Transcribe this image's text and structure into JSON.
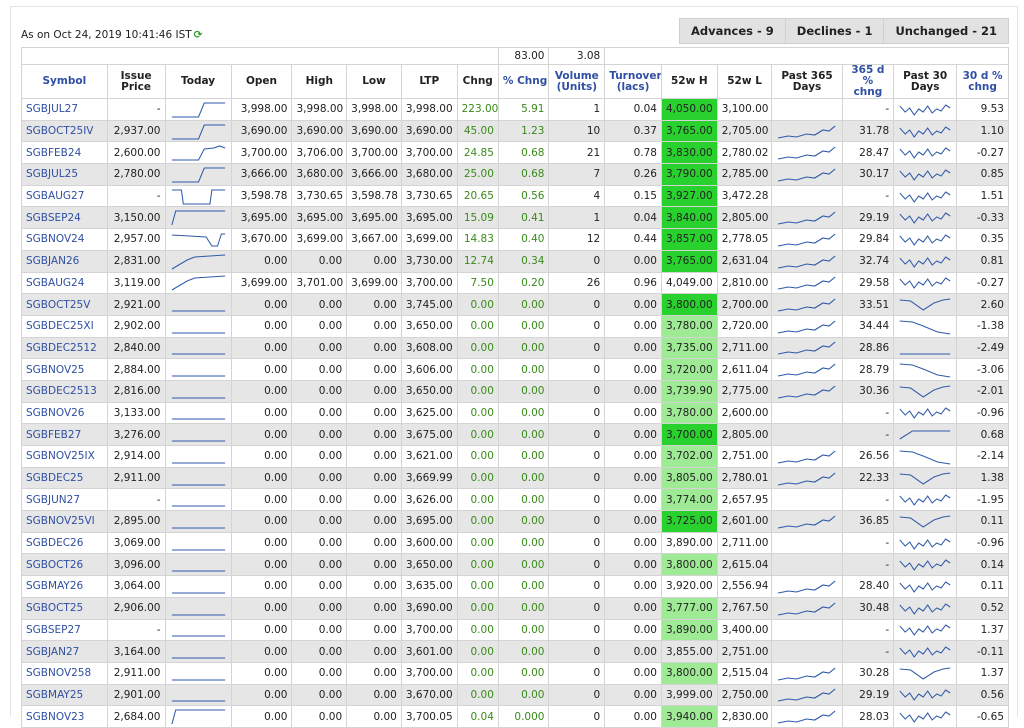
{
  "header": {
    "as_on": "As on Oct 24, 2019 10:41:46 IST",
    "refresh_icon": "refresh-icon",
    "advances": "Advances - 9",
    "declines": "Declines - 1",
    "unchanged": "Unchanged - 21"
  },
  "totals": {
    "pct_chng": "83.00",
    "volume": "3.08"
  },
  "columns": {
    "symbol": "Symbol",
    "issue_price": "Issue Price",
    "today": "Today",
    "open": "Open",
    "high": "High",
    "low": "Low",
    "ltp": "LTP",
    "chng": "Chng",
    "pct_chng": "% Chng",
    "volume": "Volume (Units)",
    "turnover": "Turnover (lacs)",
    "w52h": "52w H",
    "w52l": "52w L",
    "past365": "Past 365 Days",
    "d365chng": "365 d % chng",
    "past30": "Past 30 Days",
    "d30chng": "30 d % chng"
  },
  "colors": {
    "highlight_bright": "#29d12e",
    "highlight_light": "#9fea94",
    "link_blue": "#2f4fa3",
    "change_green": "#3a8a1a",
    "row_stripe": "#e6e6e6"
  },
  "rows": [
    {
      "symbol": "SGBJUL27",
      "issue": "-",
      "open": "3,998.00",
      "high": "3,998.00",
      "low": "3,998.00",
      "ltp": "3,998.00",
      "chng": "223.00",
      "pchng": "5.91",
      "vol": "1",
      "turn": "0.04",
      "h52": "4,050.00",
      "h52hl": "bright",
      "l52": "3,100.00",
      "d365": "-",
      "d30": "9.53",
      "today": "step_up",
      "p365": "none",
      "p30": "zig"
    },
    {
      "symbol": "SGBOCT25IV",
      "issue": "2,937.00",
      "open": "3,690.00",
      "high": "3,690.00",
      "low": "3,690.00",
      "ltp": "3,690.00",
      "chng": "45.00",
      "pchng": "1.23",
      "vol": "10",
      "turn": "0.37",
      "h52": "3,765.00",
      "h52hl": "bright",
      "l52": "2,705.00",
      "d365": "31.78",
      "d30": "1.10",
      "today": "step_up",
      "p365": "rise",
      "p30": "zig"
    },
    {
      "symbol": "SGBFEB24",
      "issue": "2,600.00",
      "open": "3,700.00",
      "high": "3,706.00",
      "low": "3,700.00",
      "ltp": "3,700.00",
      "chng": "24.85",
      "pchng": "0.68",
      "vol": "21",
      "turn": "0.78",
      "h52": "3,830.00",
      "h52hl": "bright",
      "l52": "2,780.02",
      "d365": "28.47",
      "d30": "-0.27",
      "today": "step_up_bump",
      "p365": "rise",
      "p30": "zig"
    },
    {
      "symbol": "SGBJUL25",
      "issue": "2,780.00",
      "open": "3,666.00",
      "high": "3,680.00",
      "low": "3,666.00",
      "ltp": "3,680.00",
      "chng": "25.00",
      "pchng": "0.68",
      "vol": "7",
      "turn": "0.26",
      "h52": "3,790.00",
      "h52hl": "bright",
      "l52": "2,785.00",
      "d365": "30.17",
      "d30": "0.85",
      "today": "step_up",
      "p365": "rise",
      "p30": "zig"
    },
    {
      "symbol": "SGBAUG27",
      "issue": "-",
      "open": "3,598.78",
      "high": "3,730.65",
      "low": "3,598.78",
      "ltp": "3,730.65",
      "chng": "20.65",
      "pchng": "0.56",
      "vol": "4",
      "turn": "0.15",
      "h52": "3,927.00",
      "h52hl": "bright",
      "l52": "3,472.28",
      "d365": "-",
      "d30": "1.51",
      "today": "valley",
      "p365": "none",
      "p30": "zig"
    },
    {
      "symbol": "SGBSEP24",
      "issue": "3,150.00",
      "open": "3,695.00",
      "high": "3,695.00",
      "low": "3,695.00",
      "ltp": "3,695.00",
      "chng": "15.09",
      "pchng": "0.41",
      "vol": "1",
      "turn": "0.04",
      "h52": "3,840.00",
      "h52hl": "bright",
      "l52": "2,805.00",
      "d365": "29.19",
      "d30": "-0.33",
      "today": "step_up_early",
      "p365": "rise",
      "p30": "zig"
    },
    {
      "symbol": "SGBNOV24",
      "issue": "2,957.00",
      "open": "3,670.00",
      "high": "3,699.00",
      "low": "3,667.00",
      "ltp": "3,699.00",
      "chng": "14.83",
      "pchng": "0.40",
      "vol": "12",
      "turn": "0.44",
      "h52": "3,857.00",
      "h52hl": "bright",
      "l52": "2,778.05",
      "d365": "29.84",
      "d30": "0.35",
      "today": "dip_up",
      "p365": "rise",
      "p30": "zig"
    },
    {
      "symbol": "SGBJAN26",
      "issue": "2,831.00",
      "open": "0.00",
      "high": "0.00",
      "low": "0.00",
      "ltp": "3,730.00",
      "chng": "12.74",
      "pchng": "0.34",
      "vol": "0",
      "turn": "0.00",
      "h52": "3,765.00",
      "h52hl": "bright",
      "l52": "2,631.04",
      "d365": "32.74",
      "d30": "0.81",
      "today": "ramp",
      "p365": "rise",
      "p30": "zig"
    },
    {
      "symbol": "SGBAUG24",
      "issue": "3,119.00",
      "open": "3,699.00",
      "high": "3,701.00",
      "low": "3,699.00",
      "ltp": "3,700.00",
      "chng": "7.50",
      "pchng": "0.20",
      "vol": "26",
      "turn": "0.96",
      "h52": "4,049.00",
      "h52hl": "none",
      "l52": "2,810.00",
      "d365": "29.58",
      "d30": "-0.27",
      "today": "ramp",
      "p365": "rise",
      "p30": "zig"
    },
    {
      "symbol": "SGBOCT25V",
      "issue": "2,921.00",
      "open": "0.00",
      "high": "0.00",
      "low": "0.00",
      "ltp": "3,745.00",
      "chng": "0.00",
      "pchng": "0.00",
      "vol": "0",
      "turn": "0.00",
      "h52": "3,800.00",
      "h52hl": "bright",
      "l52": "2,700.00",
      "d365": "33.51",
      "d30": "2.60",
      "today": "flat",
      "p365": "rise",
      "p30": "v"
    },
    {
      "symbol": "SGBDEC25XI",
      "issue": "2,902.00",
      "open": "0.00",
      "high": "0.00",
      "low": "0.00",
      "ltp": "3,650.00",
      "chng": "0.00",
      "pchng": "0.00",
      "vol": "0",
      "turn": "0.00",
      "h52": "3,780.00",
      "h52hl": "light",
      "l52": "2,720.00",
      "d365": "34.44",
      "d30": "-1.38",
      "today": "flat",
      "p365": "rise",
      "p30": "fall"
    },
    {
      "symbol": "SGBDEC2512",
      "issue": "2,840.00",
      "open": "0.00",
      "high": "0.00",
      "low": "0.00",
      "ltp": "3,608.00",
      "chng": "0.00",
      "pchng": "0.00",
      "vol": "0",
      "turn": "0.00",
      "h52": "3,735.00",
      "h52hl": "light",
      "l52": "2,711.00",
      "d365": "28.86",
      "d30": "-2.49",
      "today": "flat",
      "p365": "rise",
      "p30": "flat"
    },
    {
      "symbol": "SGBNOV25",
      "issue": "2,884.00",
      "open": "0.00",
      "high": "0.00",
      "low": "0.00",
      "ltp": "3,606.00",
      "chng": "0.00",
      "pchng": "0.00",
      "vol": "0",
      "turn": "0.00",
      "h52": "3,720.00",
      "h52hl": "light",
      "l52": "2,611.04",
      "d365": "28.79",
      "d30": "-3.06",
      "today": "flat",
      "p365": "rise",
      "p30": "fall"
    },
    {
      "symbol": "SGBDEC2513",
      "issue": "2,816.00",
      "open": "0.00",
      "high": "0.00",
      "low": "0.00",
      "ltp": "3,650.00",
      "chng": "0.00",
      "pchng": "0.00",
      "vol": "0",
      "turn": "0.00",
      "h52": "3,739.90",
      "h52hl": "light",
      "l52": "2,775.00",
      "d365": "30.36",
      "d30": "-2.01",
      "today": "flat",
      "p365": "rise",
      "p30": "v"
    },
    {
      "symbol": "SGBNOV26",
      "issue": "3,133.00",
      "open": "0.00",
      "high": "0.00",
      "low": "0.00",
      "ltp": "3,625.00",
      "chng": "0.00",
      "pchng": "0.00",
      "vol": "0",
      "turn": "0.00",
      "h52": "3,780.00",
      "h52hl": "light",
      "l52": "2,600.00",
      "d365": "-",
      "d30": "-0.96",
      "today": "flat",
      "p365": "none",
      "p30": "zig"
    },
    {
      "symbol": "SGBFEB27",
      "issue": "3,276.00",
      "open": "0.00",
      "high": "0.00",
      "low": "0.00",
      "ltp": "3,675.00",
      "chng": "0.00",
      "pchng": "0.00",
      "vol": "0",
      "turn": "0.00",
      "h52": "3,700.00",
      "h52hl": "bright",
      "l52": "2,805.00",
      "d365": "-",
      "d30": "0.68",
      "today": "flat",
      "p365": "none",
      "p30": "flat_up"
    },
    {
      "symbol": "SGBNOV25IX",
      "issue": "2,914.00",
      "open": "0.00",
      "high": "0.00",
      "low": "0.00",
      "ltp": "3,621.00",
      "chng": "0.00",
      "pchng": "0.00",
      "vol": "0",
      "turn": "0.00",
      "h52": "3,702.00",
      "h52hl": "light",
      "l52": "2,751.00",
      "d365": "26.56",
      "d30": "-2.14",
      "today": "flat",
      "p365": "rise",
      "p30": "fall"
    },
    {
      "symbol": "SGBDEC25",
      "issue": "2,911.00",
      "open": "0.00",
      "high": "0.00",
      "low": "0.00",
      "ltp": "3,669.99",
      "chng": "0.00",
      "pchng": "0.00",
      "vol": "0",
      "turn": "0.00",
      "h52": "3,805.00",
      "h52hl": "light",
      "l52": "2,780.01",
      "d365": "22.33",
      "d30": "1.38",
      "today": "flat",
      "p365": "rise",
      "p30": "v"
    },
    {
      "symbol": "SGBJUN27",
      "issue": "-",
      "open": "0.00",
      "high": "0.00",
      "low": "0.00",
      "ltp": "3,626.00",
      "chng": "0.00",
      "pchng": "0.00",
      "vol": "0",
      "turn": "0.00",
      "h52": "3,774.00",
      "h52hl": "light",
      "l52": "2,657.95",
      "d365": "-",
      "d30": "-1.95",
      "today": "flat",
      "p365": "none",
      "p30": "zig"
    },
    {
      "symbol": "SGBNOV25VI",
      "issue": "2,895.00",
      "open": "0.00",
      "high": "0.00",
      "low": "0.00",
      "ltp": "3,695.00",
      "chng": "0.00",
      "pchng": "0.00",
      "vol": "0",
      "turn": "0.00",
      "h52": "3,725.00",
      "h52hl": "bright",
      "l52": "2,601.00",
      "d365": "36.85",
      "d30": "0.11",
      "today": "flat",
      "p365": "rise",
      "p30": "v"
    },
    {
      "symbol": "SGBDEC26",
      "issue": "3,069.00",
      "open": "0.00",
      "high": "0.00",
      "low": "0.00",
      "ltp": "3,600.00",
      "chng": "0.00",
      "pchng": "0.00",
      "vol": "0",
      "turn": "0.00",
      "h52": "3,890.00",
      "h52hl": "none",
      "l52": "2,711.00",
      "d365": "-",
      "d30": "-0.96",
      "today": "flat",
      "p365": "none",
      "p30": "zig"
    },
    {
      "symbol": "SGBOCT26",
      "issue": "3,096.00",
      "open": "0.00",
      "high": "0.00",
      "low": "0.00",
      "ltp": "3,650.00",
      "chng": "0.00",
      "pchng": "0.00",
      "vol": "0",
      "turn": "0.00",
      "h52": "3,800.00",
      "h52hl": "light",
      "l52": "2,615.04",
      "d365": "-",
      "d30": "0.14",
      "today": "flat",
      "p365": "none",
      "p30": "zig"
    },
    {
      "symbol": "SGBMAY26",
      "issue": "3,064.00",
      "open": "0.00",
      "high": "0.00",
      "low": "0.00",
      "ltp": "3,635.00",
      "chng": "0.00",
      "pchng": "0.00",
      "vol": "0",
      "turn": "0.00",
      "h52": "3,920.00",
      "h52hl": "none",
      "l52": "2,556.94",
      "d365": "28.40",
      "d30": "0.11",
      "today": "flat",
      "p365": "rise",
      "p30": "zig"
    },
    {
      "symbol": "SGBOCT25",
      "issue": "2,906.00",
      "open": "0.00",
      "high": "0.00",
      "low": "0.00",
      "ltp": "3,690.00",
      "chng": "0.00",
      "pchng": "0.00",
      "vol": "0",
      "turn": "0.00",
      "h52": "3,777.00",
      "h52hl": "light",
      "l52": "2,767.50",
      "d365": "30.48",
      "d30": "0.52",
      "today": "flat",
      "p365": "rise",
      "p30": "zig"
    },
    {
      "symbol": "SGBSEP27",
      "issue": "-",
      "open": "0.00",
      "high": "0.00",
      "low": "0.00",
      "ltp": "3,700.00",
      "chng": "0.00",
      "pchng": "0.00",
      "vol": "0",
      "turn": "0.00",
      "h52": "3,890.00",
      "h52hl": "light",
      "l52": "3,400.00",
      "d365": "-",
      "d30": "1.37",
      "today": "flat",
      "p365": "none",
      "p30": "zig"
    },
    {
      "symbol": "SGBJAN27",
      "issue": "3,164.00",
      "open": "0.00",
      "high": "0.00",
      "low": "0.00",
      "ltp": "3,601.00",
      "chng": "0.00",
      "pchng": "0.00",
      "vol": "0",
      "turn": "0.00",
      "h52": "3,855.00",
      "h52hl": "none",
      "l52": "2,751.00",
      "d365": "-",
      "d30": "-0.11",
      "today": "flat",
      "p365": "none",
      "p30": "zig"
    },
    {
      "symbol": "SGBNOV258",
      "issue": "2,911.00",
      "open": "0.00",
      "high": "0.00",
      "low": "0.00",
      "ltp": "3,700.00",
      "chng": "0.00",
      "pchng": "0.00",
      "vol": "0",
      "turn": "0.00",
      "h52": "3,800.00",
      "h52hl": "light",
      "l52": "2,515.04",
      "d365": "30.28",
      "d30": "1.37",
      "today": "flat",
      "p365": "rise",
      "p30": "v"
    },
    {
      "symbol": "SGBMAY25",
      "issue": "2,901.00",
      "open": "0.00",
      "high": "0.00",
      "low": "0.00",
      "ltp": "3,670.00",
      "chng": "0.00",
      "pchng": "0.00",
      "vol": "0",
      "turn": "0.00",
      "h52": "3,999.00",
      "h52hl": "none",
      "l52": "2,750.00",
      "d365": "29.19",
      "d30": "0.56",
      "today": "flat",
      "p365": "rise",
      "p30": "zig"
    },
    {
      "symbol": "SGBNOV23",
      "issue": "2,684.00",
      "open": "0.00",
      "high": "0.00",
      "low": "0.00",
      "ltp": "3,700.05",
      "chng": "0.04",
      "pchng": "0.000",
      "vol": "0",
      "turn": "0.00",
      "h52": "3,940.00",
      "h52hl": "light",
      "l52": "2,830.00",
      "d365": "28.03",
      "d30": "-0.65",
      "today": "step_up_early",
      "p365": "rise",
      "p30": "zig"
    }
  ]
}
